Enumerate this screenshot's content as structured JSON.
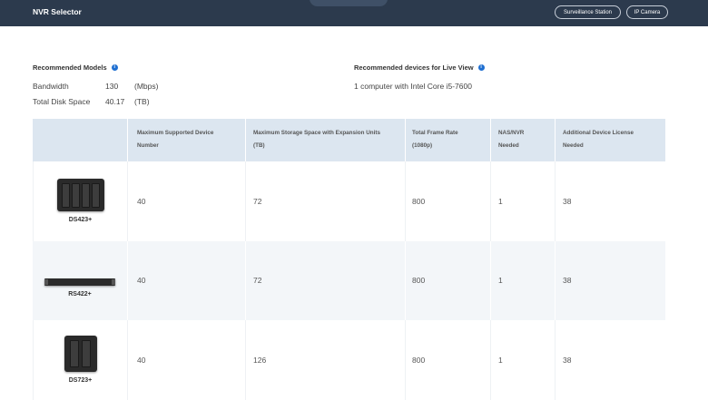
{
  "header": {
    "title": "NVR Selector",
    "buttons": [
      "Surveillance Station",
      "IP Camera"
    ]
  },
  "summary": {
    "recommended_models_title": "Recommended Models",
    "bandwidth_label": "Bandwidth",
    "bandwidth_value": "130",
    "bandwidth_unit": "(Mbps)",
    "disk_label": "Total Disk Space",
    "disk_value": "40.17",
    "disk_unit": "(TB)",
    "live_view_title": "Recommended devices for Live View",
    "live_view_value": "1 computer with Intel Core i5-7600",
    "info_glyph": "i"
  },
  "table": {
    "headers": [
      [
        "Maximum Supported Device",
        "Number"
      ],
      [
        "Maximum Storage Space with Expansion Units",
        "(TB)"
      ],
      [
        "Total Frame Rate",
        "(1080p)"
      ],
      [
        "NAS/NVR",
        "Needed"
      ],
      [
        "Additional Device License",
        "Needed"
      ]
    ],
    "rows": [
      {
        "model": "DS423+",
        "device_icon": "nas-4-bay",
        "max_devices": "40",
        "max_storage": "72",
        "frame_rate": "800",
        "nas_needed": "1",
        "licenses": "38"
      },
      {
        "model": "RS422+",
        "device_icon": "rackstation",
        "max_devices": "40",
        "max_storage": "72",
        "frame_rate": "800",
        "nas_needed": "1",
        "licenses": "38"
      },
      {
        "model": "DS723+",
        "device_icon": "nas-2-bay",
        "max_devices": "40",
        "max_storage": "126",
        "frame_rate": "800",
        "nas_needed": "1",
        "licenses": "38"
      }
    ]
  },
  "colors": {
    "header_bg": "#2c3a4d",
    "table_header_bg": "#dce6f0",
    "row_alt_bg": "#f3f6f9",
    "info_icon": "#1f6fd1"
  }
}
